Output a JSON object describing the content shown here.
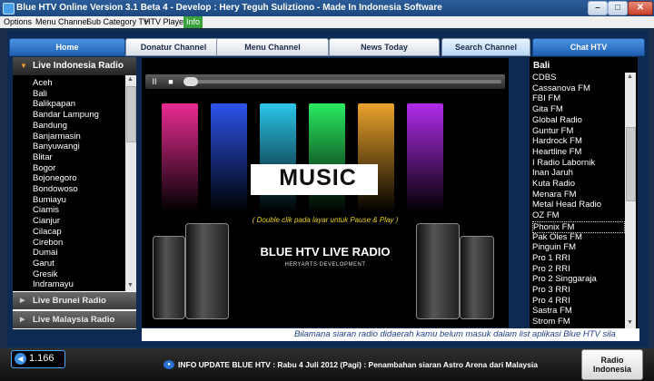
{
  "window": {
    "title": "Blue HTV Online Version 3.1 Beta 4  - Develop : Hery Teguh Suliztiono - Made In Indonesia Software",
    "min_label": "–",
    "max_label": "□",
    "close_label": "✕"
  },
  "menu": {
    "items": [
      "Options",
      "Menu Channel",
      "Sub Category TV",
      "HTV Player",
      "Info"
    ]
  },
  "tabs": [
    {
      "label": "Home"
    },
    {
      "label": "Donatur Channel"
    },
    {
      "label": "Menu Channel"
    },
    {
      "label": "News Today"
    },
    {
      "label": "Search Channel"
    },
    {
      "label": "Chat HTV"
    }
  ],
  "left_panel": {
    "header": "Live Indonesia Radio",
    "items": [
      "Aceh",
      "Bali",
      "Balikpapan",
      "Bandar Lampung",
      "Bandung",
      "Banjarmasin",
      "Banyuwangi",
      "Blitar",
      "Bogor",
      "Bojonegoro",
      "Bondowoso",
      "Bumiayu",
      "Ciamis",
      "Cianjur",
      "Cilacap",
      "Cirebon",
      "Dumai",
      "Garut",
      "Gresik",
      "Indramayu"
    ],
    "sections": [
      "Live Brunei Radio",
      "Live Malaysia Radio"
    ]
  },
  "player": {
    "pause_label": "II",
    "stop_label": "■",
    "music_text": "MUSIC",
    "hint": "( Double clik pada layar untuk Pause & Play )",
    "radio_title": "BLUE HTV LIVE RADIO",
    "radio_sub": "HERYARTS DEVELOPMENT",
    "bar_colors": [
      "#ff2fa0",
      "#2f5bff",
      "#2fd8ff",
      "#2fff6a",
      "#ffb12f",
      "#c02fff"
    ]
  },
  "right_panel": {
    "header": "Bali",
    "items": [
      "CDBS",
      "Cassanova FM",
      "FBI FM",
      "Gita FM",
      "Global Radio",
      "Guntur FM",
      "Hardrock FM",
      "Heartline FM",
      "I Radio Labornik",
      "Inan Jaruh",
      "Kuta Radio",
      "Menara FM",
      "Metal Head Radio",
      "OZ FM",
      "Phonix FM",
      "Pak Oles FM",
      "Pinguin FM",
      "Pro 1 RRI",
      "Pro 2 RRI",
      "Pro 2 Singgaraja",
      "Pro 3 RRI",
      "Pro 4 RRI",
      "Sastra FM",
      "Strom FM"
    ],
    "selected": "Phonix FM"
  },
  "marquee": "Bilamana siaran radio didaerah kamu belum masuk dalam list aplikasi Blue HTV sila",
  "status": {
    "volume": "1.166",
    "news": "INFO UPDATE BLUE HTV : Rabu 4 Juli 2012 (Pagi) : Penambahan siaran Astro Arena dari Malaysia",
    "button_line1": "Radio",
    "button_line2": "Indonesia"
  }
}
